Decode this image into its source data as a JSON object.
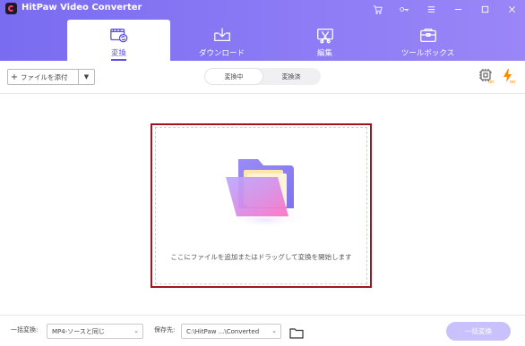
{
  "app": {
    "title": "HitPaw Video Converter"
  },
  "window_icons": [
    "cart-icon",
    "key-icon",
    "menu-icon",
    "minimize-icon",
    "maximize-icon",
    "close-icon"
  ],
  "tabs": [
    {
      "label": "変換",
      "icon": "convert-icon",
      "active": true
    },
    {
      "label": "ダウンロード",
      "icon": "download-icon",
      "active": false
    },
    {
      "label": "編集",
      "icon": "edit-icon",
      "active": false
    },
    {
      "label": "ツールボックス",
      "icon": "toolbox-icon",
      "active": false
    }
  ],
  "toolbar": {
    "add_files_label": "ファイルを添付",
    "segments": [
      {
        "label": "変換中",
        "active": true
      },
      {
        "label": "変換済",
        "active": false
      }
    ],
    "hw_accel_icon": "hardware-acceleration-icon",
    "hw_accel_state": "on",
    "lightning_icon": "lightning-icon",
    "lightning_state": "on"
  },
  "dropzone": {
    "text": "ここにファイルを追加またはドラッグして変換を開始します",
    "icon": "folder-icon"
  },
  "bottom": {
    "convert_all_to_label": "一括変換:",
    "format_value": "MP4-ソースと同じ",
    "save_to_label": "保存先:",
    "save_path": "C:\\HitPaw ...\\Converted",
    "convert_all_button": "一括変換"
  },
  "colors": {
    "header_start": "#7a6cf0",
    "header_end": "#9a86f7",
    "accent": "#5a4fe0",
    "highlight_border": "#a3141d",
    "convert_button": "#c8c1fb",
    "on_badge": "#ff8a00"
  }
}
